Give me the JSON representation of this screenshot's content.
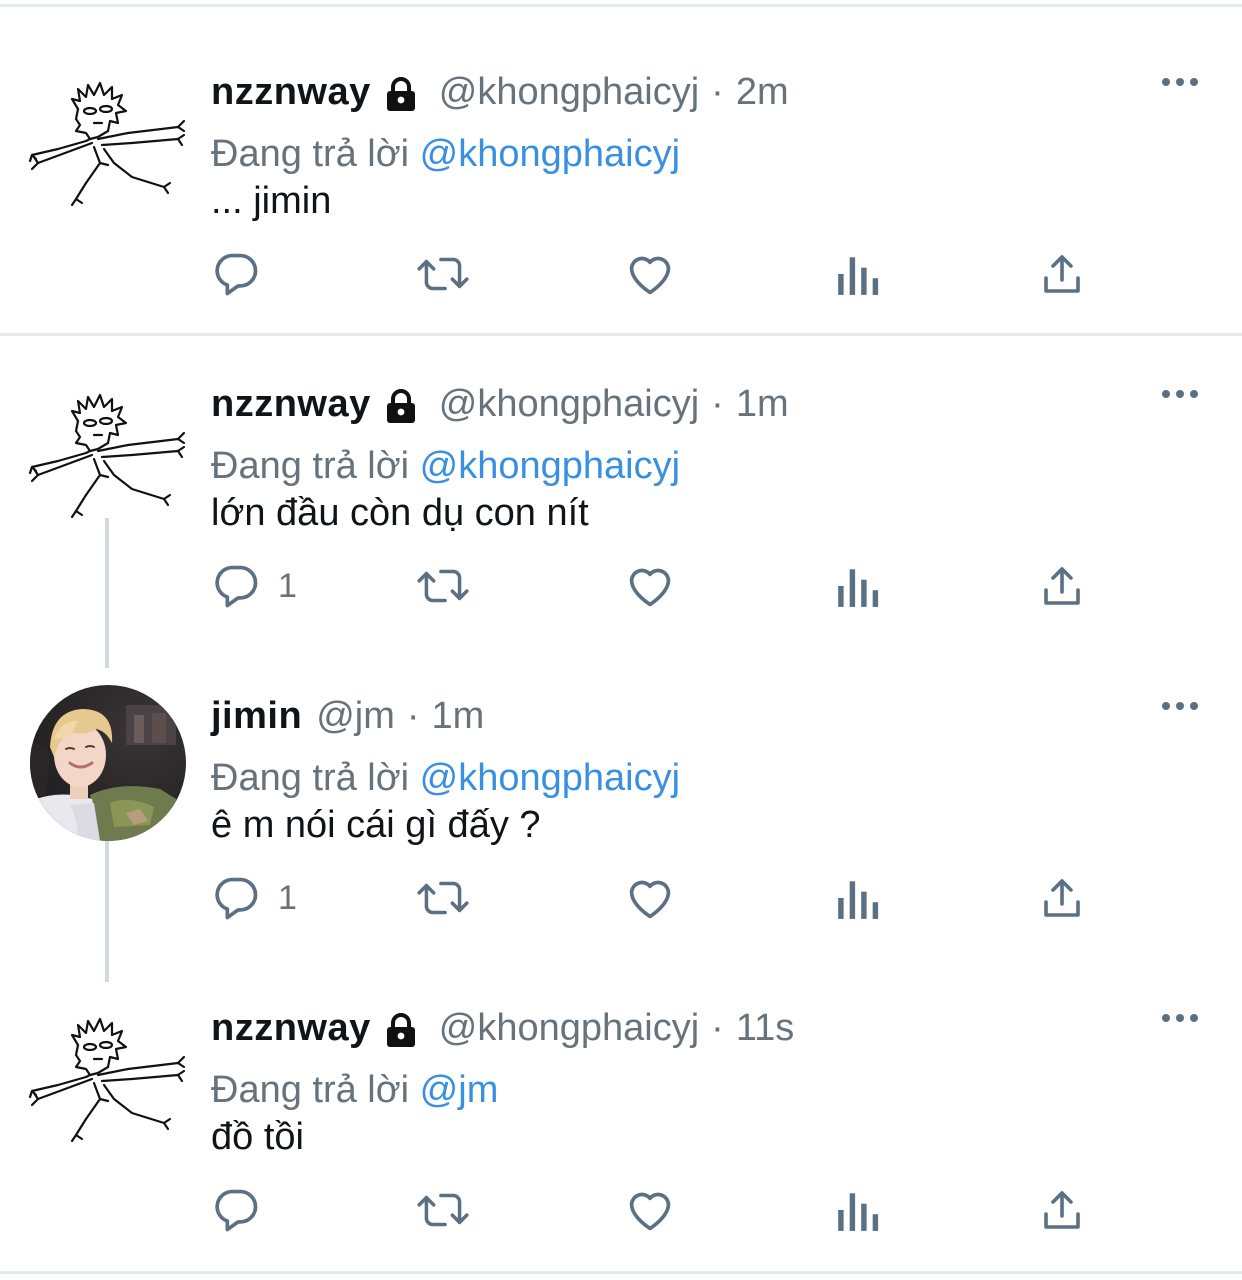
{
  "tweets": [
    {
      "name": "nzznway",
      "locked": true,
      "handle": "@khongphaicyj",
      "sep": "·",
      "time": "2m",
      "reply_prefix": "Đang trả lời",
      "reply_to": "@khongphaicyj",
      "text": "... jimin",
      "reply_count": "",
      "avatar": "sketch-doodle-avatar"
    },
    {
      "name": "nzznway",
      "locked": true,
      "handle": "@khongphaicyj",
      "sep": "·",
      "time": "1m",
      "reply_prefix": "Đang trả lời",
      "reply_to": "@khongphaicyj",
      "text": "lớn đầu còn dụ con nít",
      "reply_count": "1",
      "avatar": "sketch-doodle-avatar"
    },
    {
      "name": "jimin",
      "locked": false,
      "handle": "@jm",
      "sep": "·",
      "time": "1m",
      "reply_prefix": "Đang trả lời",
      "reply_to": "@khongphaicyj",
      "text": "ê m nói cái gì đấy ?",
      "reply_count": "1",
      "avatar": "photo-avatar"
    },
    {
      "name": "nzznway",
      "locked": true,
      "handle": "@khongphaicyj",
      "sep": "·",
      "time": "11s",
      "reply_prefix": "Đang trả lời",
      "reply_to": "@jm",
      "text": "đồ tồi",
      "reply_count": "",
      "avatar": "sketch-doodle-avatar"
    }
  ],
  "icons": {
    "reply": "reply-icon",
    "retweet": "retweet-icon",
    "like": "like-icon",
    "views": "views-icon",
    "share": "share-icon",
    "more": "more-icon",
    "lock": "lock-icon"
  },
  "colors": {
    "mention": "#3a90e0",
    "muted": "#66727c",
    "icon": "#5b7083",
    "divider": "#e6e9eb",
    "thread_line": "#cfd9de"
  }
}
